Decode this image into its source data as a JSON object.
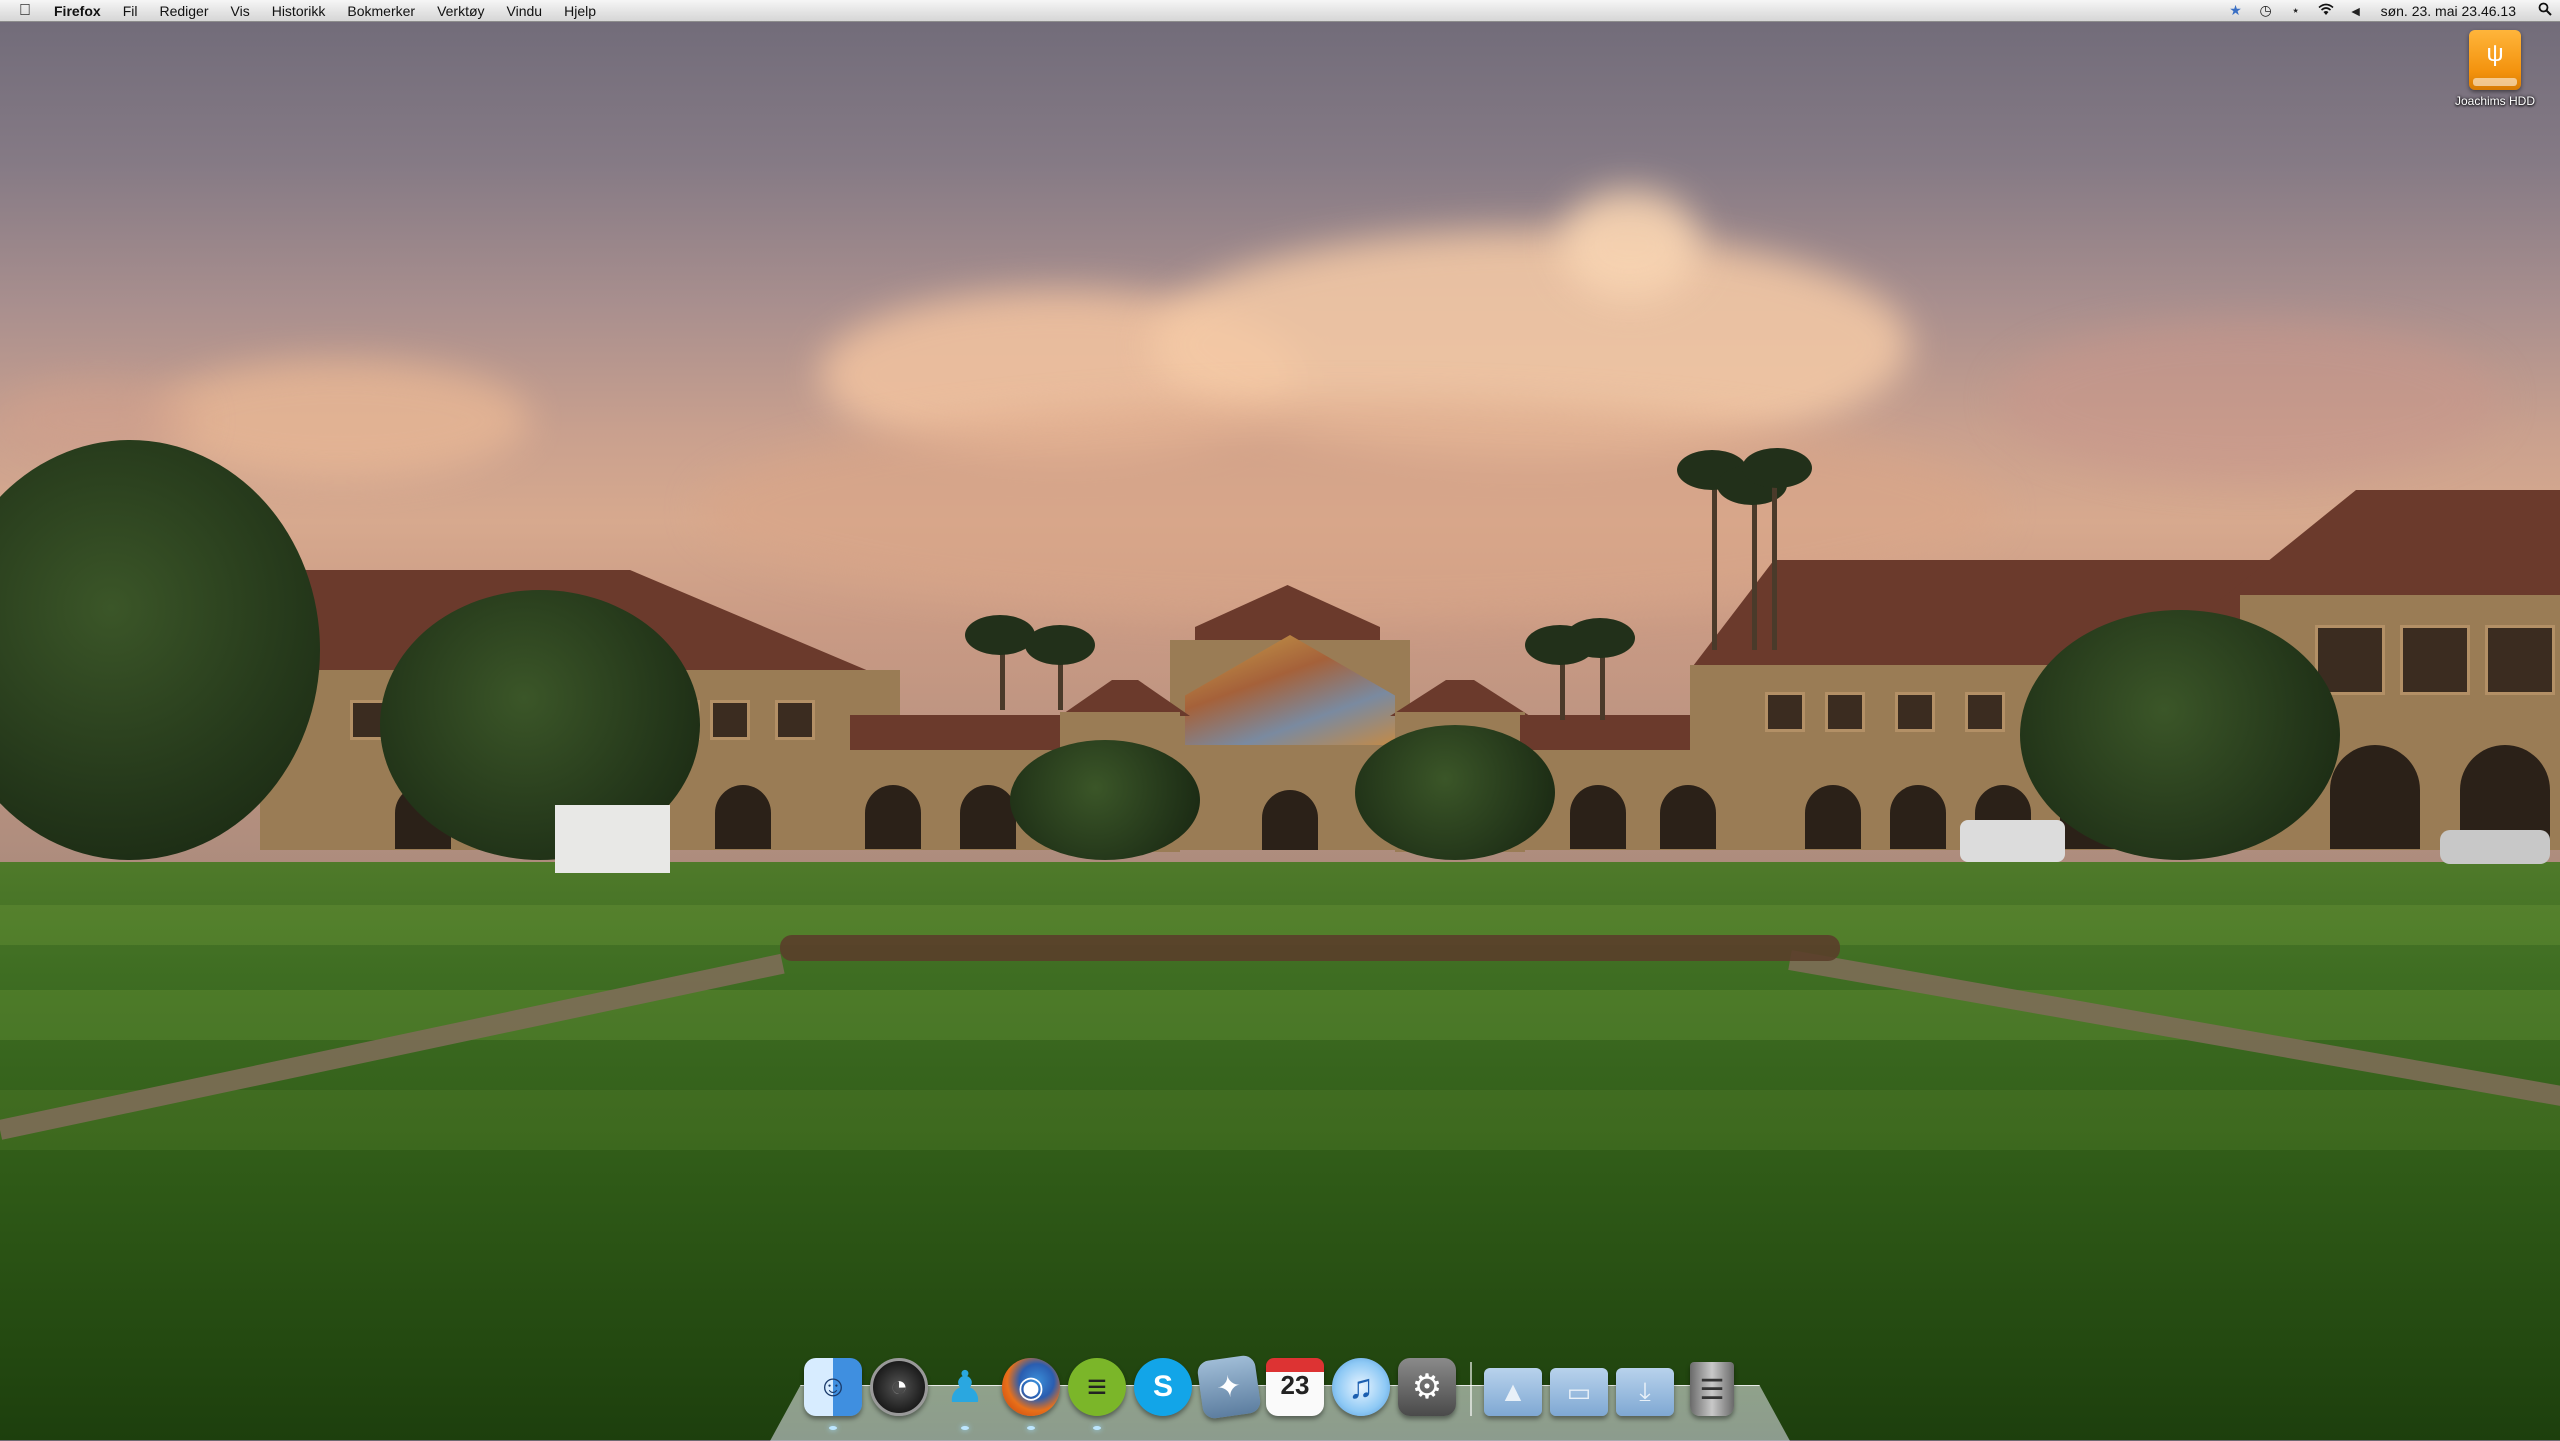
{
  "menubar": {
    "apple_icon": "apple-icon",
    "app_name": "Firefox",
    "menus": [
      "Fil",
      "Rediger",
      "Vis",
      "Historikk",
      "Bokmerker",
      "Verktøy",
      "Vindu",
      "Hjelp"
    ],
    "status_icons": [
      "time-machine-icon",
      "sync-icon",
      "bluetooth-icon",
      "wifi-icon",
      "volume-icon"
    ],
    "clock": "søn. 23. mai  23.46.13",
    "spotlight_icon": "spotlight-search-icon"
  },
  "desktop": {
    "drive_label": "Joachims HDD",
    "drive_icon": "external-usb-drive-icon"
  },
  "dock": {
    "apps": [
      {
        "name": "Finder",
        "icon": "finder-icon",
        "running": true
      },
      {
        "name": "Dashboard",
        "icon": "dashboard-icon",
        "running": false
      },
      {
        "name": "Messenger",
        "icon": "messenger-icon",
        "running": true
      },
      {
        "name": "Firefox",
        "icon": "firefox-icon",
        "running": true
      },
      {
        "name": "Spotify",
        "icon": "spotify-icon",
        "running": true
      },
      {
        "name": "Skype",
        "icon": "skype-icon",
        "running": false
      },
      {
        "name": "Mail",
        "icon": "mail-icon",
        "running": false
      },
      {
        "name": "iCal",
        "icon": "calendar-icon",
        "running": false,
        "day": "23"
      },
      {
        "name": "iTunes",
        "icon": "itunes-icon",
        "running": false
      },
      {
        "name": "System Preferences",
        "icon": "system-preferences-icon",
        "running": false
      }
    ],
    "stacks": [
      {
        "name": "Applications",
        "icon": "applications-folder-icon"
      },
      {
        "name": "Documents",
        "icon": "documents-folder-icon"
      },
      {
        "name": "Downloads",
        "icon": "downloads-folder-icon"
      }
    ],
    "trash": {
      "name": "Trash",
      "icon": "trash-icon"
    }
  }
}
